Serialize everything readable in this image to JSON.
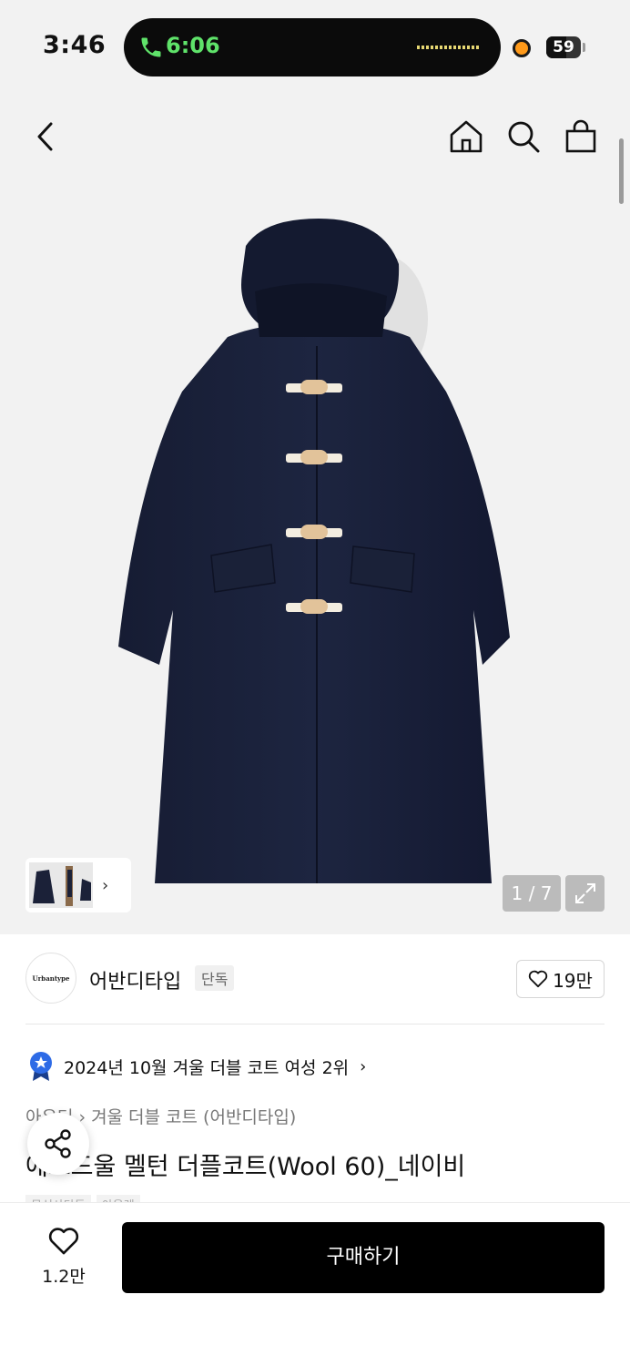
{
  "status_bar": {
    "time": "3:46",
    "call_time": "6:06",
    "battery": "59",
    "battery_level": 0.59
  },
  "gallery": {
    "counter": "1 / 7"
  },
  "brand": {
    "logo_text": "Urbantype",
    "name": "어반디타입",
    "tag": "단독",
    "likes": "19만"
  },
  "ranking": {
    "text": "2024년 10월 겨울 더블 코트 여성 2위"
  },
  "breadcrumb": {
    "category": "아우터",
    "subcategory": "겨울 더블 코트 (어반디타입)"
  },
  "product": {
    "title": "에브드울 멜턴 더플코트(Wool 60)_네이비",
    "tags": [
      "무신사단독",
      "아울렛"
    ]
  },
  "bottom_bar": {
    "wish_count": "1.2만",
    "buy_label": "구매하기"
  },
  "colors": {
    "accent_call": "#5fe36a",
    "buy_button": "#000000",
    "rank_badge": "#2e6be6"
  }
}
